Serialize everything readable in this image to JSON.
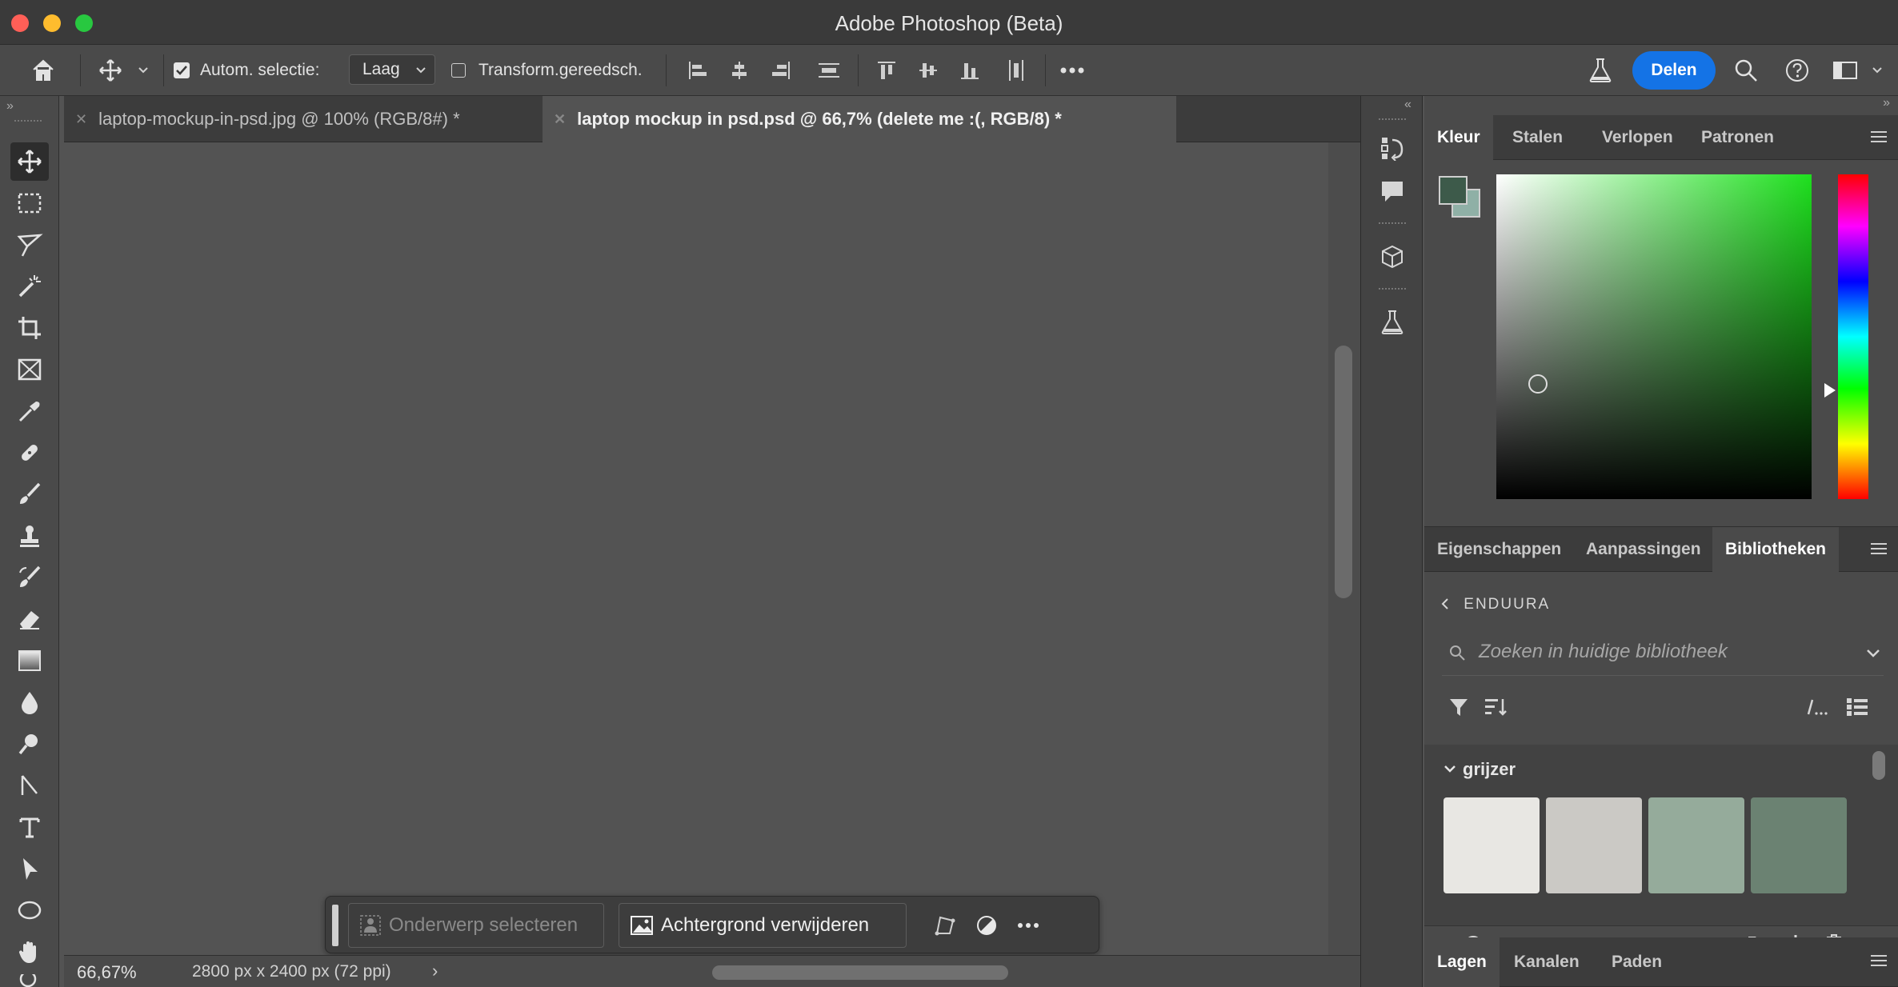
{
  "window": {
    "title": "Adobe Photoshop (Beta)"
  },
  "options_bar": {
    "auto_select_label": "Autom. selectie:",
    "auto_select_checked": true,
    "layer_select_value": "Laag",
    "transform_label": "Transform.gereedsch.",
    "transform_checked": false,
    "share_button": "Delen"
  },
  "documents": {
    "tabs": [
      {
        "label": "laptop-mockup-in-psd.jpg @ 100% (RGB/8#) *",
        "active": false
      },
      {
        "label": "laptop mockup in psd.psd @ 66,7% (delete me :(, RGB/8) *",
        "active": true
      }
    ]
  },
  "context_bar": {
    "select_subject": "Onderwerp selecteren",
    "remove_background": "Achtergrond verwijderen"
  },
  "status": {
    "zoom": "66,67%",
    "doc_info": "2800 px x 2400 px (72 ppi)"
  },
  "color_panel": {
    "tabs": [
      "Kleur",
      "Stalen",
      "Verlopen",
      "Patronen"
    ],
    "active_tab": "Kleur",
    "foreground": "#3d5a4a",
    "background": "#8fb0a6"
  },
  "properties_panel": {
    "tabs": [
      "Eigenschappen",
      "Aanpassingen",
      "Bibliotheken"
    ],
    "active_tab": "Bibliotheken"
  },
  "library": {
    "back_label": "ENDUURA",
    "search_placeholder": "Zoeken in huidige bibliotheek",
    "group_name": "grijzer",
    "swatches": [
      "#e8e7e3",
      "#cbc9c5",
      "#95ab9b",
      "#6b8272"
    ]
  },
  "layers_panel": {
    "tabs": [
      "Lagen",
      "Kanalen",
      "Paden"
    ],
    "active_tab": "Lagen"
  },
  "icons": {
    "tools": [
      "move-icon",
      "marquee-icon",
      "lasso-icon",
      "magic-wand-icon",
      "crop-icon",
      "frame-icon",
      "eyedropper-icon",
      "healing-brush-icon",
      "brush-icon",
      "stamp-icon",
      "history-brush-icon",
      "eraser-icon",
      "gradient-icon",
      "blur-icon",
      "dodge-icon",
      "pen-icon",
      "type-icon",
      "path-select-icon",
      "ellipse-icon",
      "hand-icon"
    ]
  }
}
